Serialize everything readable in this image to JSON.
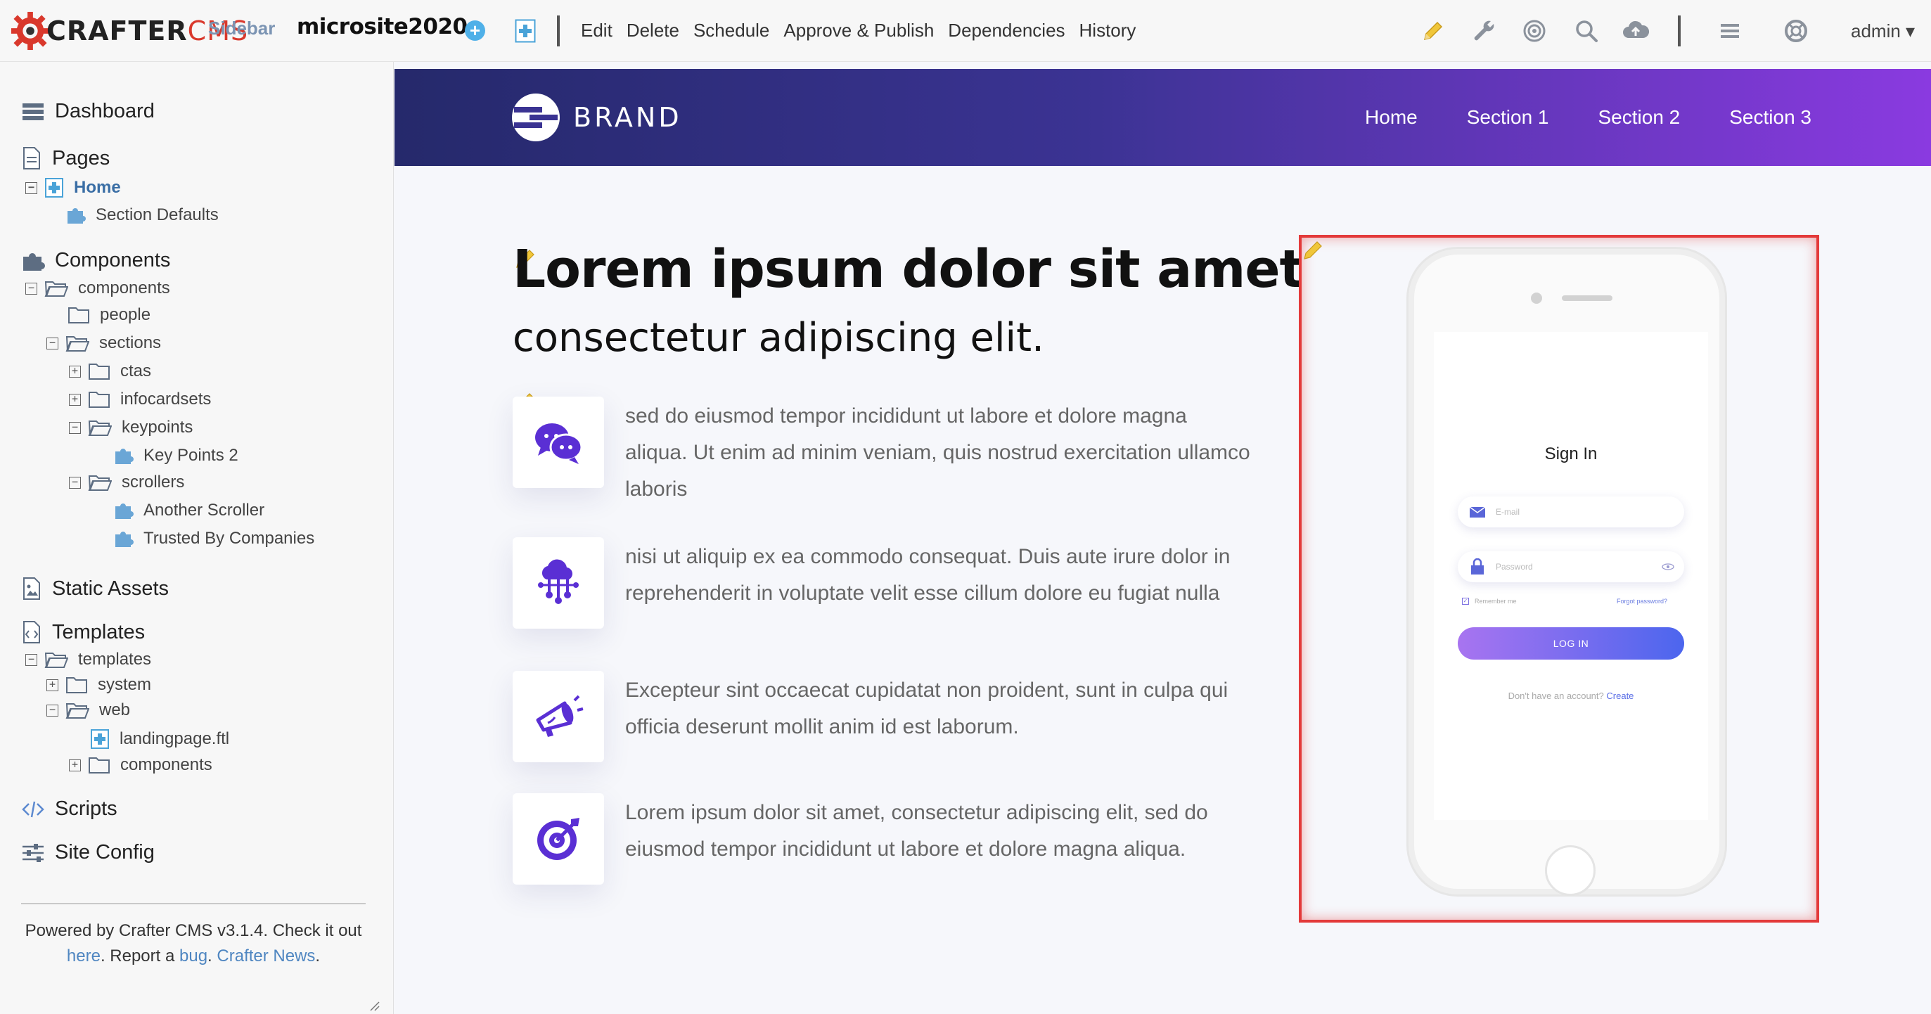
{
  "topbar": {
    "logo": {
      "brand": "CRAFTER",
      "product": "CMS"
    },
    "sidebar_label": "Sidebar",
    "site_name": "microsite2020",
    "menu": [
      "Edit",
      "Delete",
      "Schedule",
      "Approve & Publish",
      "Dependencies",
      "History"
    ],
    "right_icons": [
      "pencil-icon",
      "wrench-icon",
      "target-icon",
      "search-icon",
      "cloud-upload-icon",
      "hamburger-menu-icon",
      "lifebuoy-icon"
    ],
    "user": "admin"
  },
  "sidebar": {
    "dashboard": "Dashboard",
    "pages": "Pages",
    "home": "Home",
    "section_defaults": "Section Defaults",
    "components": "Components",
    "components_folder": "components",
    "people": "people",
    "sections": "sections",
    "ctas": "ctas",
    "infocardsets": "infocardsets",
    "keypoints": "keypoints",
    "key_points_2": "Key Points 2",
    "scrollers": "scrollers",
    "another_scroller": "Another Scroller",
    "trusted_by": "Trusted By Companies",
    "static_assets": "Static Assets",
    "templates": "Templates",
    "templates_folder": "templates",
    "system": "system",
    "web": "web",
    "landingpage": "landingpage.ftl",
    "web_components": "components",
    "scripts": "Scripts",
    "site_config": "Site Config",
    "footer": {
      "powered": "Powered by Crafter CMS v3.1.4. Check it out",
      "here": "here",
      "report": ". Report a",
      "bug": "bug",
      "news": "Crafter News"
    }
  },
  "preview": {
    "brand": "BRAND",
    "nav": [
      "Home",
      "Section 1",
      "Section 2",
      "Section 3"
    ],
    "title": "Lorem ipsum dolor sit amet",
    "subtitle": "consectetur adipiscing elit.",
    "features": [
      {
        "icon": "chat-bubbles-icon",
        "text": "sed do eiusmod tempor incididunt ut labore et dolore magna aliqua. Ut enim ad minim veniam, quis nostrud exercitation ullamco laboris"
      },
      {
        "icon": "cloud-network-icon",
        "text": "nisi ut aliquip ex ea commodo consequat. Duis aute irure dolor in reprehenderit in voluptate velit esse cillum dolore eu fugiat nulla"
      },
      {
        "icon": "megaphone-icon",
        "text": "Excepteur sint occaecat cupidatat non proident, sunt in culpa qui officia deserunt mollit anim id est laborum."
      },
      {
        "icon": "target-arrow-icon",
        "text": "Lorem ipsum dolor sit amet, consectetur adipiscing elit, sed do eiusmod tempor incididunt ut labore et dolore magna aliqua."
      }
    ],
    "phone": {
      "title": "Sign In",
      "email_placeholder": "E-mail",
      "password_placeholder": "Password",
      "remember": "Remember me",
      "forgot": "Forgot password?",
      "login": "LOG IN",
      "no_account": "Don't have an account?",
      "create": "Create"
    }
  },
  "colors": {
    "accent_red": "#e33a3a",
    "nav_gradient_start": "#25296b",
    "nav_gradient_end": "#8a3ae0",
    "icon_purple": "#5a2fd4",
    "link_blue": "#4f86c1"
  }
}
